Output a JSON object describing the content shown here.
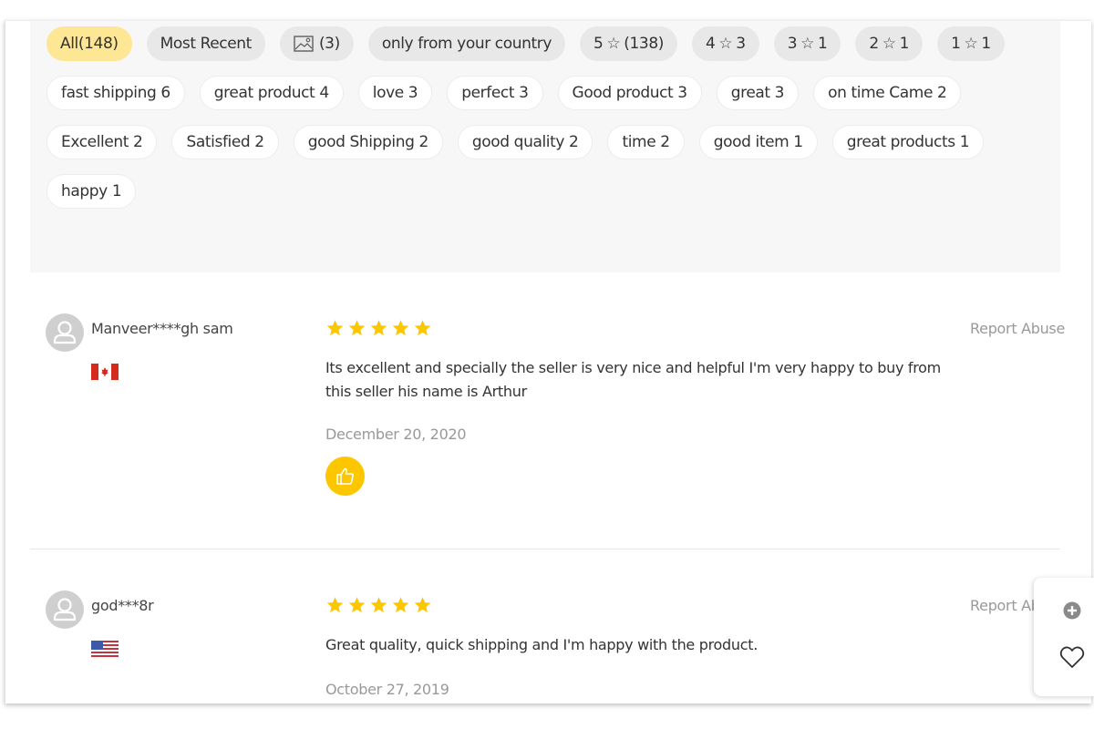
{
  "filters": {
    "sort_chips": [
      {
        "label": "All(148)",
        "active": true,
        "kind": "all"
      },
      {
        "label": "Most Recent",
        "active": false,
        "kind": "recent"
      },
      {
        "label": "(3)",
        "active": false,
        "kind": "photos",
        "icon": "image-icon"
      },
      {
        "label": "only from your country",
        "active": false,
        "kind": "country"
      }
    ],
    "star_chips": [
      {
        "stars": "5",
        "count": "(138)"
      },
      {
        "stars": "4",
        "count": "3"
      },
      {
        "stars": "3",
        "count": "1"
      },
      {
        "stars": "2",
        "count": "1"
      },
      {
        "stars": "1",
        "count": "1"
      }
    ],
    "tags": [
      "fast shipping 6",
      "great product 4",
      "love 3",
      "perfect 3",
      "Good product 3",
      "great 3",
      "on time Came 2",
      "Excellent 2",
      "Satisfied 2",
      "good Shipping 2",
      "good quality 2",
      "time 2",
      "good item 1",
      "great products 1",
      "happy 1"
    ],
    "star_icon": "star-outline-icon"
  },
  "reviews": [
    {
      "username": "Manveer****gh sam",
      "country_flag": "canada-flag-icon",
      "rating": 5,
      "text": "Its excellent and specially the seller is very nice and helpful I'm very happy to buy from this seller his name is Arthur",
      "date": "December 20, 2020",
      "report_label": "Report Abuse",
      "has_like_button": true
    },
    {
      "username": "god***8r",
      "country_flag": "usa-flag-icon",
      "rating": 5,
      "text": "Great quality, quick shipping and I'm happy with the product.",
      "date": "October 27, 2019",
      "report_label": "Report Abuse",
      "has_like_button": false
    }
  ],
  "colors": {
    "active_chip": "#fde694",
    "star_filled": "#fcc700",
    "like_button": "#fcc700",
    "muted_text": "#999999"
  },
  "floating_actions": [
    {
      "icon": "plus-circle-icon"
    },
    {
      "icon": "heart-icon"
    }
  ]
}
